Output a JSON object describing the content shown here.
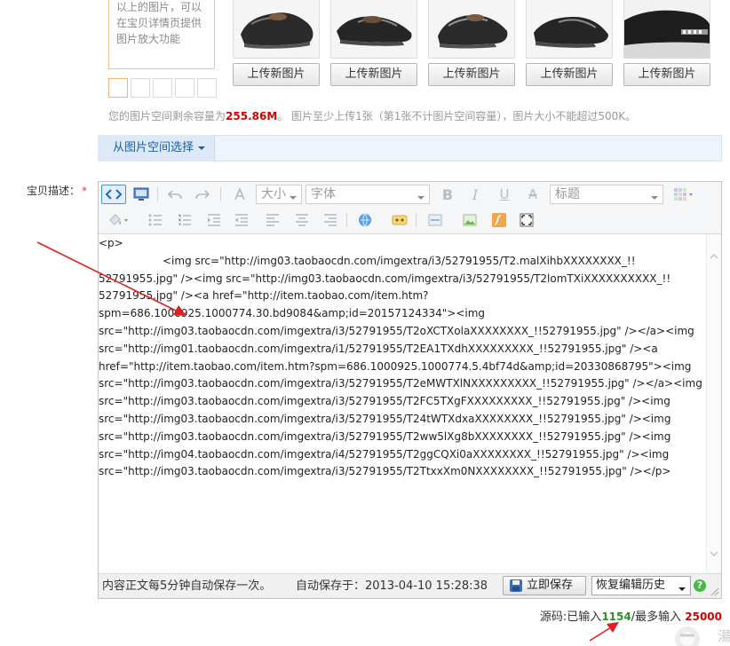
{
  "hint": {
    "lines": [
      "以上的图片，可以",
      "在宝贝详情页提供",
      "图片放大功能"
    ]
  },
  "uploads": {
    "button_label": "上传新图片",
    "slots": [
      {
        "label": "上传新图片"
      },
      {
        "label": "上传新图片"
      },
      {
        "label": "上传新图片"
      },
      {
        "label": "上传新图片"
      },
      {
        "label": "上传新图片"
      }
    ]
  },
  "space_note": {
    "prefix": "您的图片空间剩余容量为",
    "remaining": "255.86M",
    "suffix": "。 图片至少上传1张（第1张不计图片空间容量），图片大小不能超过500K。"
  },
  "space_tab": {
    "label": "从图片空间选择"
  },
  "description": {
    "label": "宝贝描述：",
    "required_mark": "*"
  },
  "toolbar": {
    "size_select": "大小",
    "font_select": "字体",
    "heading_select": "标题"
  },
  "editor": {
    "lines": [
      "<p>",
      "<img src=\"http://img03.taobaocdn.com/imgextra/i3/52791955/T2.malXihbXXXXXXXX_!!",
      "52791955.jpg\" /><img src=\"http://img03.taobaocdn.com/imgextra/i3/52791955/T2lomTXiXXXXXXXXXX_!!",
      "52791955.jpg\" /><a href=\"http://item.taobao.com/item.htm?",
      "spm=686.1000925.1000774.30.bd9084&amp;id=20157124334\"><img",
      "src=\"http://img03.taobaocdn.com/imgextra/i3/52791955/T2oXCTXolaXXXXXXXX_!!52791955.jpg\" /></a><img",
      "src=\"http://img01.taobaocdn.com/imgextra/i1/52791955/T2EA1TXdhXXXXXXXXX_!!52791955.jpg\" /><a",
      "href=\"http://item.taobao.com/item.htm?spm=686.1000925.1000774.5.4bf74d&amp;id=20330868795\"><img",
      "src=\"http://img03.taobaocdn.com/imgextra/i3/52791955/T2eMWTXlNXXXXXXXXX_!!52791955.jpg\" /></a><img",
      "src=\"http://img03.taobaocdn.com/imgextra/i3/52791955/T2FC5TXgFXXXXXXXXX_!!52791955.jpg\" /><img",
      "src=\"http://img03.taobaocdn.com/imgextra/i3/52791955/T24tWTXdxaXXXXXXXX_!!52791955.jpg\" /><img",
      "src=\"http://img03.taobaocdn.com/imgextra/i3/52791955/T2ww5lXg8bXXXXXXXX_!!52791955.jpg\" /><img",
      "src=\"http://img04.taobaocdn.com/imgextra/i4/52791955/T2ggCQXi0aXXXXXXXX_!!52791955.jpg\" /><img",
      "src=\"http://img03.taobaocdn.com/imgextra/i3/52791955/T2TtxxXm0NXXXXXXXX_!!52791955.jpg\" /></p>"
    ]
  },
  "status": {
    "autosave_note": "内容正文每5分钟自动保存一次。",
    "autosave_time": "自动保存于：2013-04-10 15:28:38",
    "save_now": "立即保存",
    "restore_history": "恢复编辑历史",
    "help": "?"
  },
  "counter": {
    "prefix": "源码:已输入",
    "current": "1154",
    "middle": "/最多输入",
    "max": "25000"
  },
  "corner": {
    "glyph": "湯"
  },
  "colors": {
    "accent_red": "#d40000",
    "link_blue": "#1c5ea8",
    "arrow_red": "#e02020"
  }
}
